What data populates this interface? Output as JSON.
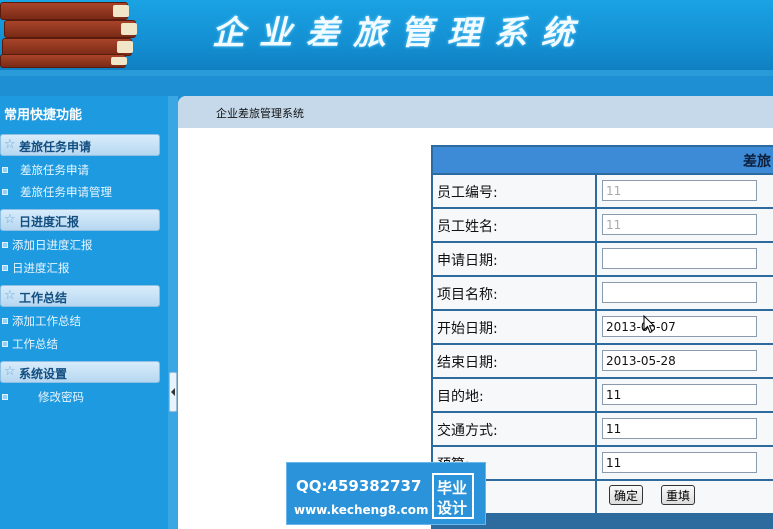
{
  "header": {
    "title": "企业差旅管理系统"
  },
  "sidebar": {
    "title": "常用快捷功能",
    "sections": [
      {
        "label": "差旅任务申请",
        "items": [
          "差旅任务申请",
          "差旅任务申请管理"
        ]
      },
      {
        "label": "日进度汇报",
        "items": [
          "添加日进度汇报",
          "日进度汇报"
        ]
      },
      {
        "label": "工作总结",
        "items": [
          "添加工作总结",
          "工作总结"
        ]
      },
      {
        "label": "系统设置",
        "items": [
          "修改密码"
        ]
      }
    ]
  },
  "breadcrumb": "企业差旅管理系统",
  "form": {
    "heading": "差旅",
    "fields": [
      {
        "label": "员工编号:",
        "value": "11"
      },
      {
        "label": "员工姓名:",
        "value": "11"
      },
      {
        "label": "申请日期:",
        "value": ""
      },
      {
        "label": "项目名称:",
        "value": ""
      },
      {
        "label": "开始日期:",
        "value": "2013-05-07"
      },
      {
        "label": "结束日期:",
        "value": "2013-05-28"
      },
      {
        "label": "目的地:",
        "value": "11"
      },
      {
        "label": "交通方式:",
        "value": "11"
      },
      {
        "label": "预算:",
        "value": "11"
      }
    ],
    "submit_label": "确定",
    "reset_label": "重填"
  },
  "watermark": {
    "qq": "QQ:459382737",
    "site": "www.kecheng8.com",
    "badge_line1": "毕业",
    "badge_line2": "设计"
  }
}
